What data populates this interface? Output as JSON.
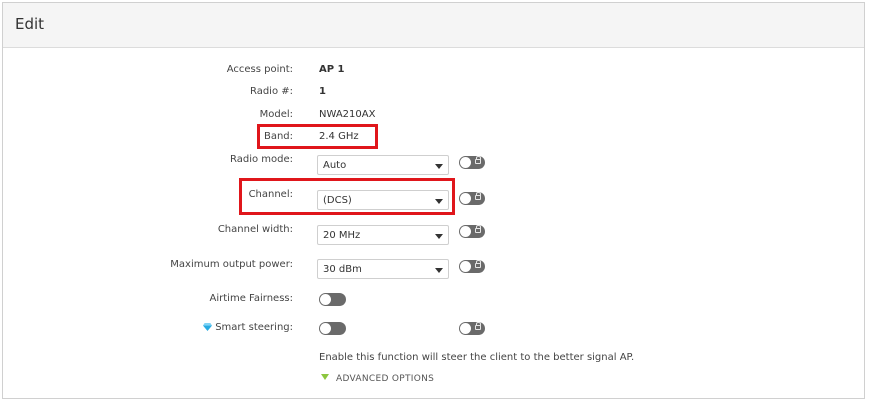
{
  "dialog": {
    "title": "Edit"
  },
  "fields": {
    "access_point": {
      "label": "Access point:",
      "value": "AP 1"
    },
    "radio_num": {
      "label": "Radio #:",
      "value": "1"
    },
    "model": {
      "label": "Model:",
      "value": "NWA210AX"
    },
    "band": {
      "label": "Band:",
      "value": "2.4 GHz"
    },
    "radio_mode": {
      "label": "Radio mode:",
      "value": "Auto"
    },
    "channel": {
      "label": "Channel:",
      "value": "(DCS)"
    },
    "channel_width": {
      "label": "Channel width:",
      "value": "20 MHz"
    },
    "max_output_power": {
      "label": "Maximum output power:",
      "value": "30 dBm"
    },
    "airtime_fairness": {
      "label": "Airtime Fairness:",
      "enabled": false
    },
    "smart_steering": {
      "label": "Smart steering:",
      "enabled": false,
      "help": "Enable this function will steer the client to the better signal AP."
    }
  },
  "advanced": {
    "label": "ADVANCED OPTIONS"
  },
  "colors": {
    "highlight": "#e0161b",
    "toggle_off": "#6a6a6a",
    "advanced_arrow": "#8cc63f",
    "gem": "#29abe2"
  },
  "icons": {
    "lock": "lock-toggle-icon",
    "gem": "diamond-icon",
    "dropdown": "chevron-down-icon",
    "advanced": "triangle-down-icon"
  }
}
